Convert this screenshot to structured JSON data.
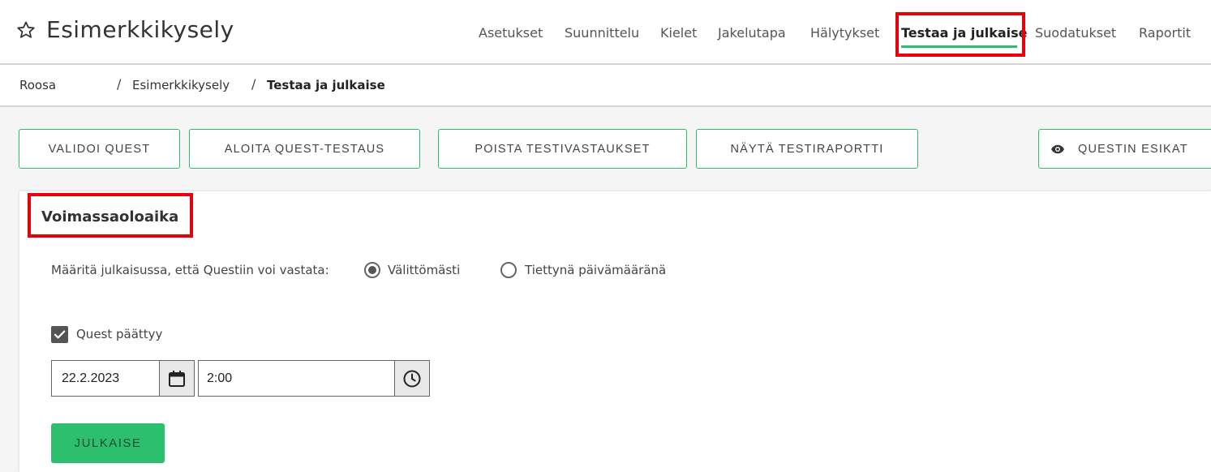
{
  "app": {
    "title": "Esimerkkikysely",
    "favorite_icon": "star-outline-icon"
  },
  "nav": {
    "items": [
      {
        "label": "Asetukset"
      },
      {
        "label": "Suunnittelu"
      },
      {
        "label": "Kielet"
      },
      {
        "label": "Jakelutapa"
      },
      {
        "label": "Hälytykset"
      },
      {
        "label": "Testaa ja julkaise",
        "active": true
      },
      {
        "label": "Suodatukset"
      },
      {
        "label": "Raportit"
      }
    ],
    "active_color": "#2bbf6e"
  },
  "breadcrumb": {
    "items": [
      "Roosa",
      "Esimerkkikysely",
      "Testaa ja julkaise"
    ],
    "separator": "/"
  },
  "actions": {
    "validate": "VALIDOI QUEST",
    "start_testing": "ALOITA QUEST-TESTAUS",
    "delete_test_answers": "POISTA TESTIVASTAUKSET",
    "show_test_report": "NÄYTÄ TESTIRAPORTTI",
    "preview": "QUESTIN ESIKAT",
    "preview_icon": "eye-icon"
  },
  "validity": {
    "title": "Voimassaoloaika",
    "answer_prompt": "Määritä julkaisussa, että Questiin voi vastata:",
    "options": [
      {
        "label": "Välittömästi",
        "selected": true
      },
      {
        "label": "Tiettynä päivämääränä",
        "selected": false
      }
    ],
    "quest_ends_label": "Quest päättyy",
    "quest_ends_checked": true,
    "end_date": "22.2.2023",
    "end_time": "2:00",
    "calendar_icon": "calendar-icon",
    "clock_icon": "clock-icon",
    "publish_label": "JULKAISE"
  },
  "colors": {
    "accent": "#2bbf6e",
    "highlight": "#e8000b",
    "text": "#333333",
    "background": "#f5f5f5"
  }
}
